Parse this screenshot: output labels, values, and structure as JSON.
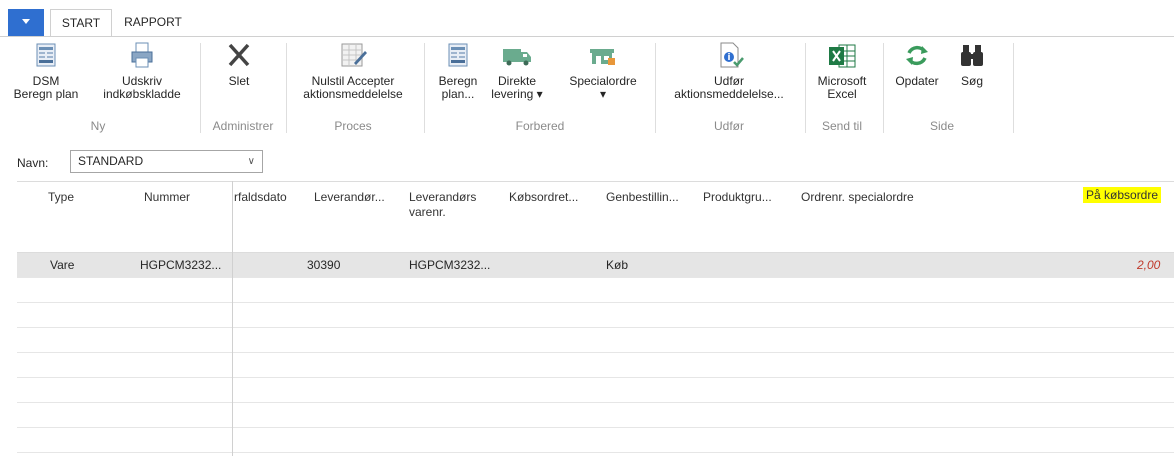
{
  "tabs": {
    "start": "START",
    "rapport": "RAPPORT"
  },
  "ribbon": {
    "dsm": [
      "DSM",
      "Beregn plan"
    ],
    "udskriv": [
      "Udskriv",
      "indkøbskladde"
    ],
    "slet": "Slet",
    "nulstil": [
      "Nulstil Accepter",
      "aktionsmeddelelse"
    ],
    "beregn": [
      "Beregn",
      "plan..."
    ],
    "direkte": [
      "Direkte",
      "levering ▾"
    ],
    "special": [
      "Specialordre",
      "▾"
    ],
    "udfor": [
      "Udfør",
      "aktionsmeddelelse..."
    ],
    "excel": [
      "Microsoft",
      "Excel"
    ],
    "opdater": "Opdater",
    "sog": "Søg",
    "groups": {
      "ny": "Ny",
      "administrer": "Administrer",
      "proces": "Proces",
      "forbered": "Forbered",
      "udfor": "Udfør",
      "sendtil": "Send til",
      "side": "Side"
    }
  },
  "name": {
    "label": "Navn:",
    "value": "STANDARD"
  },
  "columns": {
    "type": "Type",
    "nummer": "Nummer",
    "forfaldsdato": "rfaldsdato",
    "leverandor": "Leverandør...",
    "levvarenr1": "Leverandørs",
    "levvarenr2": "varenr.",
    "kobsordret": "Købsordret...",
    "genbestilling": "Genbestillin...",
    "produktgruppe": "Produktgru...",
    "ordrenr": "Ordrenr. specialordre",
    "paakobsordre": "På købsordre"
  },
  "rows": [
    {
      "type": "Vare",
      "nummer": "HGPCM3232...",
      "leverandor": "30390",
      "levvarenr": "HGPCM3232...",
      "genbestilling": "Køb",
      "paakobsordre": "2,00"
    }
  ],
  "colors": {
    "accent": "#2f6fd0",
    "highlight": "#ffff00",
    "selectedRow": "#e5e5e5",
    "valueRed": "#c0392b"
  }
}
